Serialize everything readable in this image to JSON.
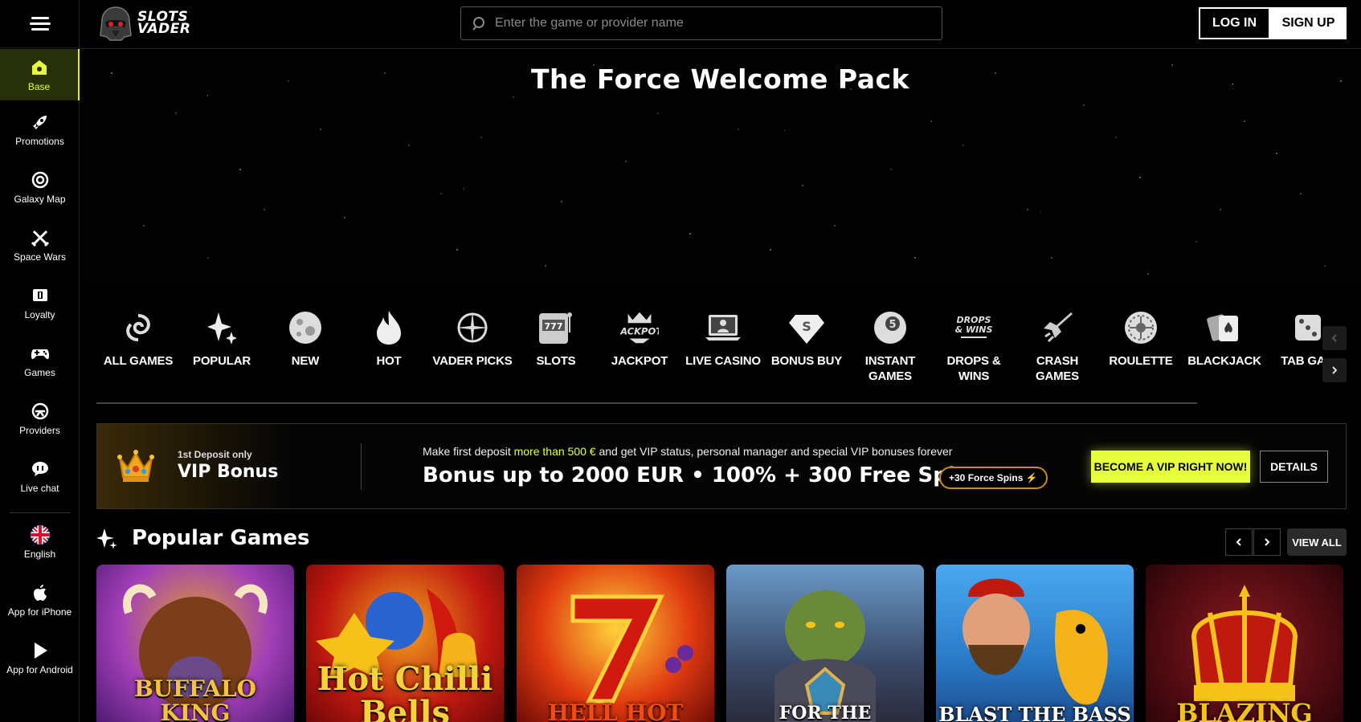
{
  "header": {
    "logo_line1": "SLOTS",
    "logo_line2": "VADER",
    "search_placeholder": "Enter the game or provider name",
    "login_label": "LOG IN",
    "signup_label": "SIGN UP"
  },
  "sidebar": {
    "items": [
      {
        "label": "Base",
        "icon": "home-icon",
        "active": true
      },
      {
        "label": "Promotions",
        "icon": "rocket-icon"
      },
      {
        "label": "Galaxy Map",
        "icon": "galaxy-icon"
      },
      {
        "label": "Space Wars",
        "icon": "crossed-swords-icon"
      },
      {
        "label": "Loyalty",
        "icon": "loyalty-icon"
      },
      {
        "label": "Games",
        "icon": "gamepad-icon"
      },
      {
        "label": "Providers",
        "icon": "providers-icon"
      },
      {
        "label": "Live chat",
        "icon": "chat-icon"
      },
      {
        "label": "English",
        "icon": "uk-flag-icon"
      },
      {
        "label": "App for iPhone",
        "icon": "apple-icon"
      },
      {
        "label": "App for Android",
        "icon": "play-icon"
      }
    ]
  },
  "hero": {
    "title": "The Force Welcome Pack"
  },
  "categories": [
    {
      "label": "ALL GAMES",
      "icon": "spiral-galaxy-icon"
    },
    {
      "label": "POPULAR",
      "icon": "sparkles-icon"
    },
    {
      "label": "NEW",
      "icon": "planet-icon"
    },
    {
      "label": "HOT",
      "icon": "flame-icon"
    },
    {
      "label": "VADER PICKS",
      "icon": "crosshair-icon"
    },
    {
      "label": "SLOTS",
      "icon": "slot-machine-icon"
    },
    {
      "label": "JACKPOT",
      "icon": "jackpot-icon"
    },
    {
      "label": "LIVE CASINO",
      "icon": "laptop-dealer-icon"
    },
    {
      "label": "BONUS BUY",
      "icon": "diamond-icon"
    },
    {
      "label": "INSTANT GAMES",
      "icon": "eight-ball-icon"
    },
    {
      "label": "DROPS & WINS",
      "icon": "drops-wins-icon"
    },
    {
      "label": "CRASH GAMES",
      "icon": "spaceship-icon"
    },
    {
      "label": "ROULETTE",
      "icon": "roulette-icon"
    },
    {
      "label": "BLACKJACK",
      "icon": "cards-icon"
    },
    {
      "label": "TAB GAM",
      "icon": "dice-icon"
    }
  ],
  "vip": {
    "small": "1st Deposit only",
    "big": "VIP Bonus",
    "text_before": "Make first deposit ",
    "text_highlight": "more than 500 €",
    "text_after": " and get VIP status, personal manager and special VIP bonuses forever",
    "headline": "Bonus up to 2000 EUR • 100% + 300 Free Spins",
    "badge": "+30 Force Spins ⚡",
    "cta_label": "BECOME A VIP RIGHT NOW!",
    "details_label": "DETAILS"
  },
  "popular": {
    "title": "Popular Games",
    "view_all": "VIEW ALL",
    "games": [
      {
        "title": "BUFFALO KING",
        "bg": "#7a2fa8"
      },
      {
        "title": "Hot Chilli Bells",
        "bg": "#b0140c"
      },
      {
        "title": "HELL HOT",
        "bg": "#c2260c"
      },
      {
        "title": "FOR THE",
        "bg": "#4a6a8a"
      },
      {
        "title": "BLAST THE BASS",
        "bg": "#2d7ac8"
      },
      {
        "title": "BLAZING",
        "bg": "#6a0e10"
      }
    ]
  },
  "colors": {
    "accent": "#e5ff3d",
    "background": "#000000"
  }
}
